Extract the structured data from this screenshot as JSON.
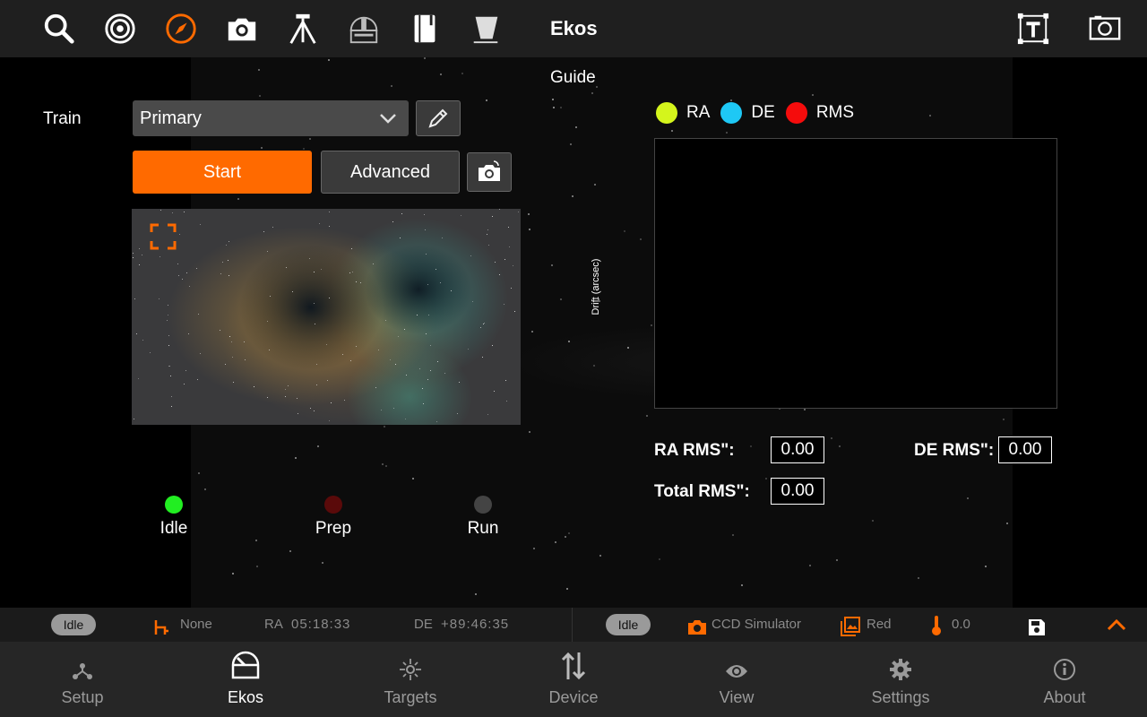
{
  "toolbar": {
    "title": "Ekos",
    "icons": [
      "search-icon",
      "target-icon",
      "compass-icon",
      "camera-icon",
      "tripod-icon",
      "observatory-icon",
      "notebook-icon",
      "flat-panel-icon",
      "text-tool-icon",
      "screenshot-icon"
    ]
  },
  "guide": {
    "module_title": "Guide",
    "train_label": "Train",
    "train_value": "Primary",
    "start_label": "Start",
    "advanced_label": "Advanced",
    "status_lights": [
      {
        "label": "Idle",
        "color": "#22ee22"
      },
      {
        "label": "Prep",
        "color": "#5a0a0a"
      },
      {
        "label": "Run",
        "color": "#444444"
      }
    ]
  },
  "plot": {
    "legend": [
      {
        "label": "RA",
        "color": "#d4f51c"
      },
      {
        "label": "DE",
        "color": "#1ec8f5"
      },
      {
        "label": "RMS",
        "color": "#f50c0c"
      }
    ],
    "y_label": "Drift (arcsec)",
    "ra_rms_label": "RA RMS\":",
    "ra_rms_value": "0.00",
    "de_rms_label": "DE RMS\":",
    "de_rms_value": "0.00",
    "total_rms_label": "Total RMS\":",
    "total_rms_value": "0.00"
  },
  "statusbar": {
    "mount_state": "Idle",
    "mount_target": "None",
    "ra_label": "RA",
    "ra_value": "05:18:33",
    "de_label": "DE",
    "de_value": "+89:46:35",
    "camera_state": "Idle",
    "camera_name": "CCD Simulator",
    "filter": "Red",
    "temperature": "0.0",
    "accent_color": "#ff6a00"
  },
  "nav": [
    {
      "label": "Setup",
      "icon": "setup-icon"
    },
    {
      "label": "Ekos",
      "icon": "ekos-dome-icon",
      "active": true
    },
    {
      "label": "Targets",
      "icon": "targets-icon"
    },
    {
      "label": "Device",
      "icon": "device-icon"
    },
    {
      "label": "View",
      "icon": "eye-icon"
    },
    {
      "label": "Settings",
      "icon": "gear-icon"
    },
    {
      "label": "About",
      "icon": "info-icon"
    }
  ]
}
